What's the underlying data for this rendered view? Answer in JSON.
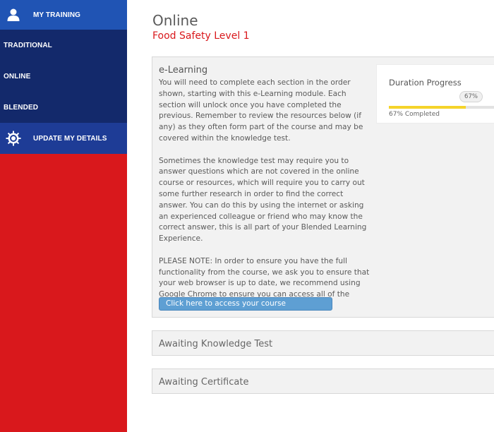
{
  "sidebar": {
    "items": [
      {
        "label": "MY TRAINING",
        "icon": "user-icon"
      },
      {
        "label": "TRADITIONAL"
      },
      {
        "label": "ONLINE"
      },
      {
        "label": "BLENDED"
      },
      {
        "label": "UPDATE MY DETAILS",
        "icon": "gear-icon"
      }
    ]
  },
  "main": {
    "title": "Online",
    "subtitle": "Food Safety Level 1",
    "elearning": {
      "title": "e-Learning",
      "paragraphs": [
        "You will need to complete each section in the order shown, starting with this e-Learning module. Each section will unlock once you have completed the previous. Remember to review the resources below (if any) as they often form part of the course and may be covered within the knowledge test.",
        "Sometimes the knowledge test may require you to answer questions which are not covered in the online course or resources, which will require you to carry out some further research in order to find the correct answer. You can do this by using the internet or asking an experienced colleague or friend who may know the correct answer, this is all part of your Blended Learning Experience.",
        "PLEASE NOTE: In order to ensure you have the full functionality from the course, we ask you to ensure that your web browser is up to date, we recommend using Google Chrome to ensure you can access all of the features."
      ],
      "button_label": "Click here to access your course"
    },
    "progress": {
      "title": "Duration Progress",
      "bubble": "67%",
      "caption": "67% Completed",
      "value": 0.67
    },
    "knowledge_test": {
      "title": "Awaiting Knowledge Test"
    },
    "certificate": {
      "title": "Awaiting Certificate"
    }
  },
  "colors": {
    "sidebar_red": "#d9181c",
    "nav_blue_top": "#2054b4",
    "nav_navy": "#13296b",
    "nav_update": "#1e3c96",
    "accent_red": "#d9181c",
    "button_blue": "#5e9fd3",
    "progress_yellow": "#f5d42a"
  }
}
